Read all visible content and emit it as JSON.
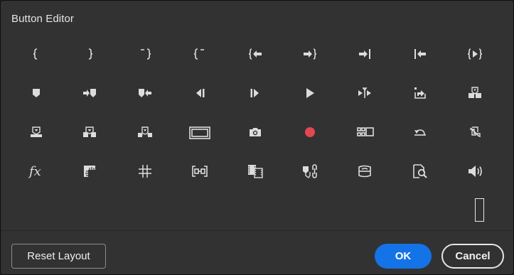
{
  "dialog": {
    "title": "Button Editor"
  },
  "icons": [
    "mark-in-icon",
    "mark-out-icon",
    "clear-in-icon",
    "clear-out-icon",
    "go-to-in-icon",
    "go-to-out-icon",
    "go-to-out-point-icon",
    "go-to-in-point-icon",
    "play-in-to-out-icon",
    "add-marker-icon",
    "go-to-next-marker-icon",
    "go-to-previous-marker-icon",
    "step-back-icon",
    "step-forward-icon",
    "play-stop-icon",
    "play-around-icon",
    "export-frame-icon",
    "lift-icon",
    "extract-icon",
    "insert-icon",
    "overwrite-icon",
    "safe-margins-icon",
    "camera-icon",
    "record-icon",
    "multi-camera-icon",
    "loop-icon",
    "toggle-proxies-icon",
    "fx-icon",
    "show-rulers-icon",
    "show-guides-icon",
    "snap-icon",
    "comparison-view-icon",
    "marker-link-icon",
    "vr-video-icon",
    "global-fx-mute-icon",
    "volume-icon"
  ],
  "footer": {
    "reset_label": "Reset Layout",
    "ok_label": "OK",
    "cancel_label": "Cancel"
  },
  "colors": {
    "accent": "#1473e6",
    "record": "#e34850",
    "icon": "#dcdcdc"
  }
}
